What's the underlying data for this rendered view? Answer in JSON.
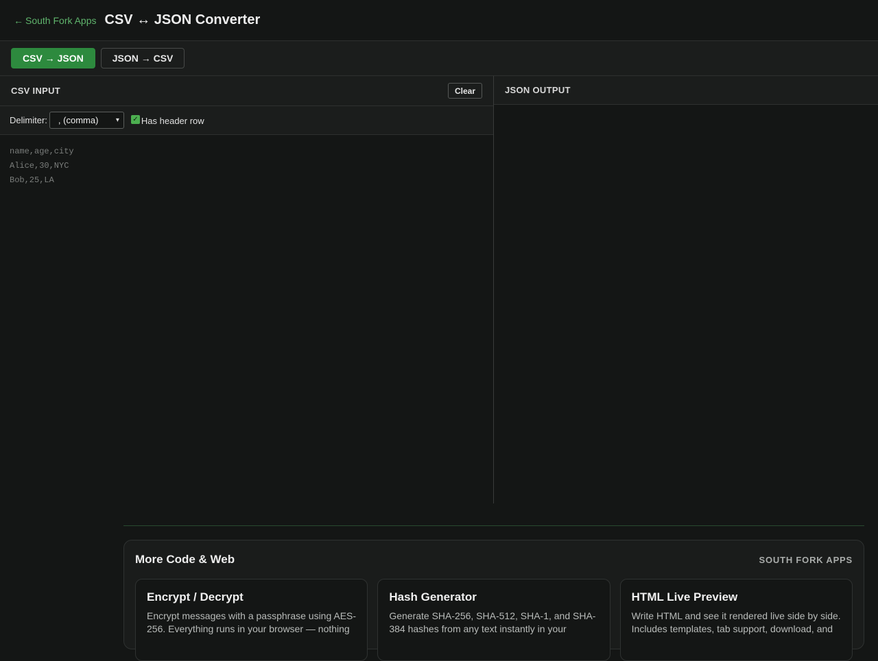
{
  "header": {
    "back_label": "South Fork Apps",
    "title": "CSV ↔ JSON Converter"
  },
  "modes": [
    {
      "label": "CSV → JSON",
      "active": true
    },
    {
      "label": "JSON → CSV",
      "active": false
    }
  ],
  "input_panel": {
    "title": "CSV INPUT",
    "clear_label": "Clear",
    "delimiter_label": "Delimiter:",
    "delimiter_value": ", (comma)",
    "header_row_label": "Has header row",
    "header_row_checked": true,
    "placeholder": "name,age,city\nAlice,30,NYC\nBob,25,LA"
  },
  "output_panel": {
    "title": "JSON OUTPUT",
    "content": ""
  },
  "more": {
    "title": "More Code & Web",
    "brand": "SOUTH FORK APPS",
    "tools": [
      {
        "name": "Encrypt / Decrypt",
        "desc": "Encrypt messages with a passphrase using AES-256. Everything runs in your browser — nothing"
      },
      {
        "name": "Hash Generator",
        "desc": "Generate SHA-256, SHA-512, SHA-1, and SHA-384 hashes from any text instantly in your"
      },
      {
        "name": "HTML Live Preview",
        "desc": "Write HTML and see it rendered live side by side. Includes templates, tab support, download, and"
      }
    ]
  },
  "colors": {
    "accent": "#2d8a3e",
    "link": "#5fb36c",
    "background": "#141615"
  }
}
